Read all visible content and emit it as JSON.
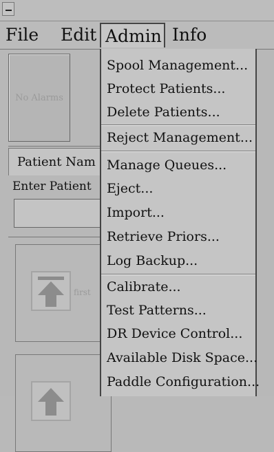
{
  "menubar": {
    "file": "File",
    "edit": "Edit",
    "admin": "Admin",
    "info": "Info"
  },
  "alarms": {
    "label": "No Alarms"
  },
  "patient": {
    "tab": "Patient Nam",
    "enter_label": "Enter Patient",
    "input_value": ""
  },
  "navigation": {
    "first_label": "first"
  },
  "admin_menu": {
    "items": [
      "Spool Management...",
      "Protect Patients...",
      "Delete Patients...",
      "Reject Management...",
      "Manage Queues...",
      "Eject...",
      "Import...",
      "Retrieve Priors...",
      "Log Backup...",
      "Calibrate...",
      "Test Patterns...",
      "DR Device Control...",
      "Available Disk Space...",
      "Paddle Configuration..."
    ]
  }
}
